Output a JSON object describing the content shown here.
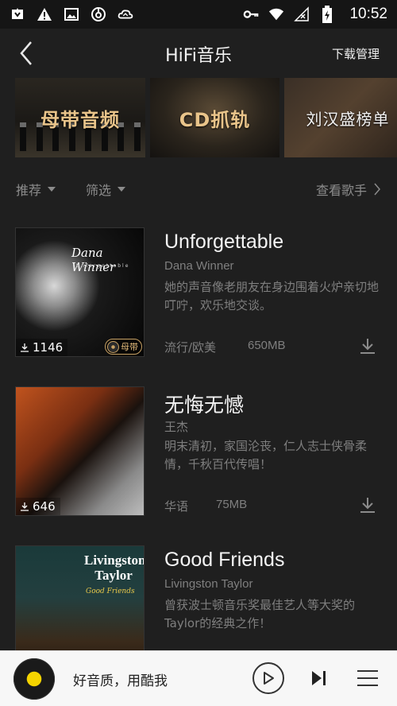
{
  "status_bar": {
    "time": "10:52",
    "left_icons": [
      "app-icon",
      "warning-icon",
      "image-icon",
      "netease-icon",
      "cloud-sync-icon"
    ],
    "right_icons": [
      "key-icon",
      "wifi-icon",
      "no-sim-icon",
      "battery-charging-icon"
    ]
  },
  "header": {
    "title": "HiFi音乐",
    "download_manager": "下载管理"
  },
  "banners": [
    {
      "label": "母带音频"
    },
    {
      "label": "CD抓轨"
    },
    {
      "label": "刘汉盛榜单"
    }
  ],
  "filters": {
    "recommend": "推荐",
    "sort": "筛选",
    "view_singers": "查看歌手"
  },
  "albums": [
    {
      "title": "Unforgettable",
      "artist": "Dana Winner",
      "description": "她的声音像老朋友在身边围着火炉亲切地叮咛，欢乐地交谈。",
      "genre": "流行/欧美",
      "size": "650MB",
      "play_count": "1146",
      "badge": "母带"
    },
    {
      "title": "无悔无憾",
      "artist": "王杰",
      "description": "明末清初，家国沦丧，仁人志士侠骨柔情，千秋百代传唱！",
      "genre": "华语",
      "size": "75MB",
      "play_count": "646"
    },
    {
      "title": "Good Friends",
      "artist": "Livingston Taylor",
      "description": "曾获波士顿音乐奖最佳艺人等大奖的Taylor的经典之作！"
    }
  ],
  "player": {
    "now_playing": "好音质，用酷我"
  },
  "colors": {
    "background": "#1f1f1f",
    "gold_accent": "#e9c48a",
    "player_bg": "#f7f7f7",
    "vinyl_center": "#f5d400"
  }
}
